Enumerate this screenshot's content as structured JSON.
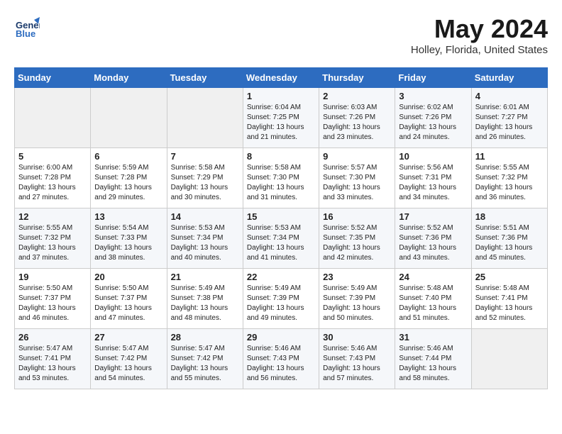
{
  "logo": {
    "line1": "General",
    "line2": "Blue"
  },
  "title": "May 2024",
  "location": "Holley, Florida, United States",
  "days_of_week": [
    "Sunday",
    "Monday",
    "Tuesday",
    "Wednesday",
    "Thursday",
    "Friday",
    "Saturday"
  ],
  "weeks": [
    [
      {
        "day": "",
        "empty": true
      },
      {
        "day": "",
        "empty": true
      },
      {
        "day": "",
        "empty": true
      },
      {
        "day": "1",
        "sunrise": "6:04 AM",
        "sunset": "7:25 PM",
        "daylight": "13 hours and 21 minutes."
      },
      {
        "day": "2",
        "sunrise": "6:03 AM",
        "sunset": "7:26 PM",
        "daylight": "13 hours and 23 minutes."
      },
      {
        "day": "3",
        "sunrise": "6:02 AM",
        "sunset": "7:26 PM",
        "daylight": "13 hours and 24 minutes."
      },
      {
        "day": "4",
        "sunrise": "6:01 AM",
        "sunset": "7:27 PM",
        "daylight": "13 hours and 26 minutes."
      }
    ],
    [
      {
        "day": "5",
        "sunrise": "6:00 AM",
        "sunset": "7:28 PM",
        "daylight": "13 hours and 27 minutes."
      },
      {
        "day": "6",
        "sunrise": "5:59 AM",
        "sunset": "7:28 PM",
        "daylight": "13 hours and 29 minutes."
      },
      {
        "day": "7",
        "sunrise": "5:58 AM",
        "sunset": "7:29 PM",
        "daylight": "13 hours and 30 minutes."
      },
      {
        "day": "8",
        "sunrise": "5:58 AM",
        "sunset": "7:30 PM",
        "daylight": "13 hours and 31 minutes."
      },
      {
        "day": "9",
        "sunrise": "5:57 AM",
        "sunset": "7:30 PM",
        "daylight": "13 hours and 33 minutes."
      },
      {
        "day": "10",
        "sunrise": "5:56 AM",
        "sunset": "7:31 PM",
        "daylight": "13 hours and 34 minutes."
      },
      {
        "day": "11",
        "sunrise": "5:55 AM",
        "sunset": "7:32 PM",
        "daylight": "13 hours and 36 minutes."
      }
    ],
    [
      {
        "day": "12",
        "sunrise": "5:55 AM",
        "sunset": "7:32 PM",
        "daylight": "13 hours and 37 minutes."
      },
      {
        "day": "13",
        "sunrise": "5:54 AM",
        "sunset": "7:33 PM",
        "daylight": "13 hours and 38 minutes."
      },
      {
        "day": "14",
        "sunrise": "5:53 AM",
        "sunset": "7:34 PM",
        "daylight": "13 hours and 40 minutes."
      },
      {
        "day": "15",
        "sunrise": "5:53 AM",
        "sunset": "7:34 PM",
        "daylight": "13 hours and 41 minutes."
      },
      {
        "day": "16",
        "sunrise": "5:52 AM",
        "sunset": "7:35 PM",
        "daylight": "13 hours and 42 minutes."
      },
      {
        "day": "17",
        "sunrise": "5:52 AM",
        "sunset": "7:36 PM",
        "daylight": "13 hours and 43 minutes."
      },
      {
        "day": "18",
        "sunrise": "5:51 AM",
        "sunset": "7:36 PM",
        "daylight": "13 hours and 45 minutes."
      }
    ],
    [
      {
        "day": "19",
        "sunrise": "5:50 AM",
        "sunset": "7:37 PM",
        "daylight": "13 hours and 46 minutes."
      },
      {
        "day": "20",
        "sunrise": "5:50 AM",
        "sunset": "7:37 PM",
        "daylight": "13 hours and 47 minutes."
      },
      {
        "day": "21",
        "sunrise": "5:49 AM",
        "sunset": "7:38 PM",
        "daylight": "13 hours and 48 minutes."
      },
      {
        "day": "22",
        "sunrise": "5:49 AM",
        "sunset": "7:39 PM",
        "daylight": "13 hours and 49 minutes."
      },
      {
        "day": "23",
        "sunrise": "5:49 AM",
        "sunset": "7:39 PM",
        "daylight": "13 hours and 50 minutes."
      },
      {
        "day": "24",
        "sunrise": "5:48 AM",
        "sunset": "7:40 PM",
        "daylight": "13 hours and 51 minutes."
      },
      {
        "day": "25",
        "sunrise": "5:48 AM",
        "sunset": "7:41 PM",
        "daylight": "13 hours and 52 minutes."
      }
    ],
    [
      {
        "day": "26",
        "sunrise": "5:47 AM",
        "sunset": "7:41 PM",
        "daylight": "13 hours and 53 minutes."
      },
      {
        "day": "27",
        "sunrise": "5:47 AM",
        "sunset": "7:42 PM",
        "daylight": "13 hours and 54 minutes."
      },
      {
        "day": "28",
        "sunrise": "5:47 AM",
        "sunset": "7:42 PM",
        "daylight": "13 hours and 55 minutes."
      },
      {
        "day": "29",
        "sunrise": "5:46 AM",
        "sunset": "7:43 PM",
        "daylight": "13 hours and 56 minutes."
      },
      {
        "day": "30",
        "sunrise": "5:46 AM",
        "sunset": "7:43 PM",
        "daylight": "13 hours and 57 minutes."
      },
      {
        "day": "31",
        "sunrise": "5:46 AM",
        "sunset": "7:44 PM",
        "daylight": "13 hours and 58 minutes."
      },
      {
        "day": "",
        "empty": true
      }
    ]
  ]
}
